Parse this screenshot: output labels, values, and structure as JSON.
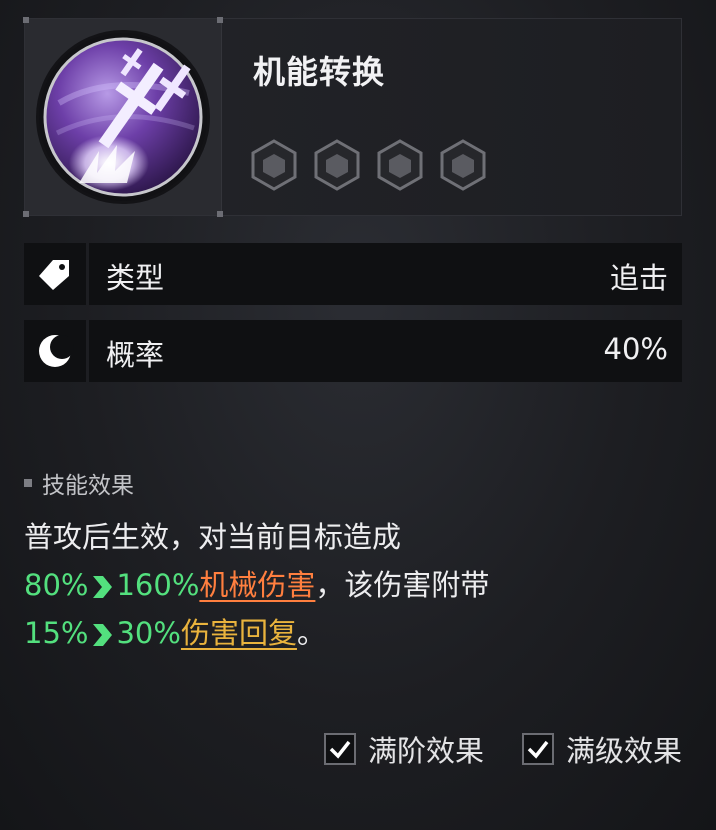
{
  "skill": {
    "name": "机能转换",
    "icon": "crossed-swords-orb-icon",
    "upgrade_slots": 4
  },
  "stats": [
    {
      "icon": "tag-icon",
      "label": "类型",
      "value": "追击"
    },
    {
      "icon": "crescent-moon-icon",
      "label": "概率",
      "value": "40%"
    }
  ],
  "effect": {
    "header": "技能效果",
    "line1": "普攻后生效，对当前目标造成",
    "dmg_from": "80%",
    "dmg_to": "160%",
    "dmg_type": "机械伤害",
    "mid_text": "，该伤害附带",
    "heal_from": "15%",
    "heal_to": "30%",
    "heal_type": "伤害回复",
    "end": "。"
  },
  "toggles": {
    "max_rank_label": "满阶效果",
    "max_rank_checked": true,
    "max_level_label": "满级效果",
    "max_level_checked": true
  },
  "colors": {
    "upgrade_green": "#53e07e",
    "damage_orange": "#ff7f3f",
    "heal_gold": "#e9b33d",
    "skill_purple": "#7a4fb6"
  }
}
